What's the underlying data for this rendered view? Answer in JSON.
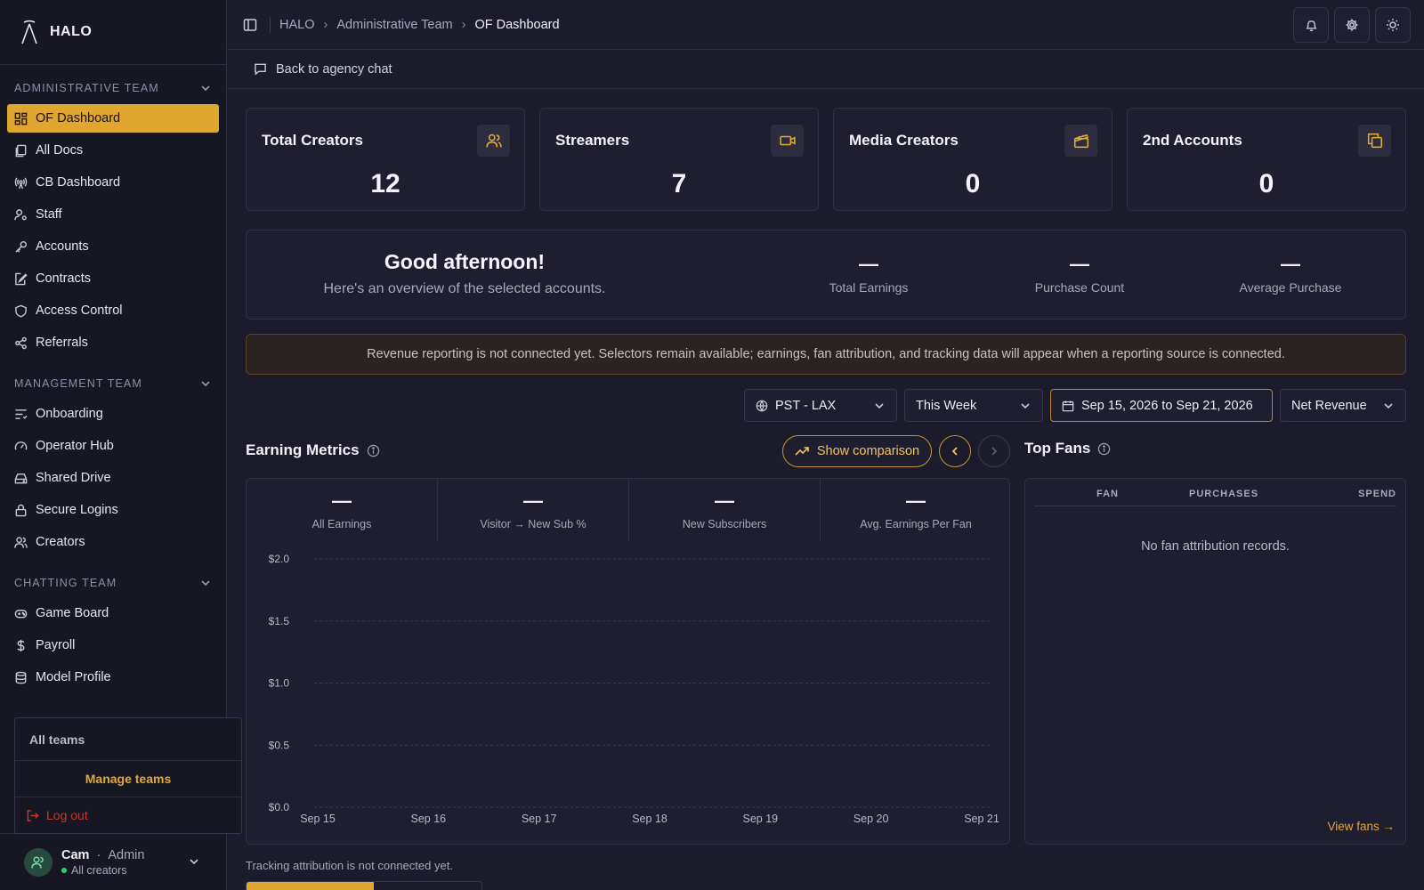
{
  "brand": {
    "name": "HALO"
  },
  "sidebar": {
    "sections": [
      {
        "title": "Administrative Team",
        "items": [
          {
            "label": "OF Dashboard",
            "icon": "dashboard-icon",
            "active": true
          },
          {
            "label": "All Docs",
            "icon": "docs-icon"
          },
          {
            "label": "CB Dashboard",
            "icon": "broadcast-icon"
          },
          {
            "label": "Staff",
            "icon": "staff-icon"
          },
          {
            "label": "Accounts",
            "icon": "key-icon"
          },
          {
            "label": "Contracts",
            "icon": "contract-icon"
          },
          {
            "label": "Access Control",
            "icon": "shield-icon"
          },
          {
            "label": "Referrals",
            "icon": "share-icon"
          }
        ]
      },
      {
        "title": "Management Team",
        "items": [
          {
            "label": "Onboarding",
            "icon": "onboarding-icon"
          },
          {
            "label": "Operator Hub",
            "icon": "gauge-icon"
          },
          {
            "label": "Shared Drive",
            "icon": "drive-icon"
          },
          {
            "label": "Secure Logins",
            "icon": "lock-icon"
          },
          {
            "label": "Creators",
            "icon": "users-icon"
          }
        ]
      },
      {
        "title": "Chatting Team",
        "items": [
          {
            "label": "Game Board",
            "icon": "gamepad-icon"
          },
          {
            "label": "Payroll",
            "icon": "dollar-icon"
          },
          {
            "label": "Model Profile",
            "icon": "database-icon"
          }
        ]
      }
    ]
  },
  "team_menu": {
    "title": "All teams",
    "manage": "Manage teams",
    "logout": "Log out"
  },
  "user": {
    "name": "Cam",
    "separator": "·",
    "role": "Admin",
    "scope": "All creators"
  },
  "breadcrumb": [
    "HALO",
    "Administrative Team",
    "OF Dashboard"
  ],
  "subbar": {
    "back_label": "Back to agency chat"
  },
  "stats": [
    {
      "title": "Total Creators",
      "value": "12",
      "icon": "users-icon"
    },
    {
      "title": "Streamers",
      "value": "7",
      "icon": "video-icon"
    },
    {
      "title": "Media Creators",
      "value": "0",
      "icon": "clapperboard-icon"
    },
    {
      "title": "2nd Accounts",
      "value": "0",
      "icon": "copy-icon"
    }
  ],
  "overview": {
    "greeting": "Good afternoon!",
    "subtitle": "Here's an overview of the selected accounts.",
    "metrics": [
      {
        "value": "—",
        "label": "Total Earnings"
      },
      {
        "value": "—",
        "label": "Purchase Count"
      },
      {
        "value": "—",
        "label": "Average Purchase"
      }
    ]
  },
  "banner": {
    "text": "Revenue reporting is not connected yet. Selectors remain available; earnings, fan attribution, and tracking data will appear when a reporting source is connected."
  },
  "filters": {
    "timezone": "PST - LAX",
    "period": "This Week",
    "date_range": "Sep 15, 2026 to Sep 21, 2026",
    "metric": "Net Revenue"
  },
  "earning": {
    "title": "Earning Metrics",
    "compare_label": "Show comparison",
    "kpis": [
      {
        "value": "—",
        "label": "All Earnings"
      },
      {
        "value": "—",
        "label": "Visitor → New Sub %"
      },
      {
        "value": "—",
        "label": "New Subscribers"
      },
      {
        "value": "—",
        "label": "Avg. Earnings Per Fan"
      }
    ]
  },
  "chart_data": {
    "type": "line",
    "title": "",
    "xlabel": "",
    "ylabel": "",
    "categories": [
      "Sep 15",
      "Sep 16",
      "Sep 17",
      "Sep 18",
      "Sep 19",
      "Sep 20",
      "Sep 21"
    ],
    "y_ticks": [
      "$0.0",
      "$0.5",
      "$1.0",
      "$1.5",
      "$2.0"
    ],
    "ylim": [
      0,
      2
    ],
    "series": [],
    "grid": true
  },
  "fans": {
    "title": "Top Fans",
    "columns": [
      "Fan",
      "Purchases",
      "Spend"
    ],
    "empty": "No fan attribution records.",
    "view_all": "View fans →"
  },
  "tracking": {
    "text": "Tracking attribution is not connected yet."
  },
  "colors": {
    "accent": "#dfa630",
    "background": "#1b1b2b",
    "card": "#1e1e30",
    "sidebar": "#171724"
  }
}
